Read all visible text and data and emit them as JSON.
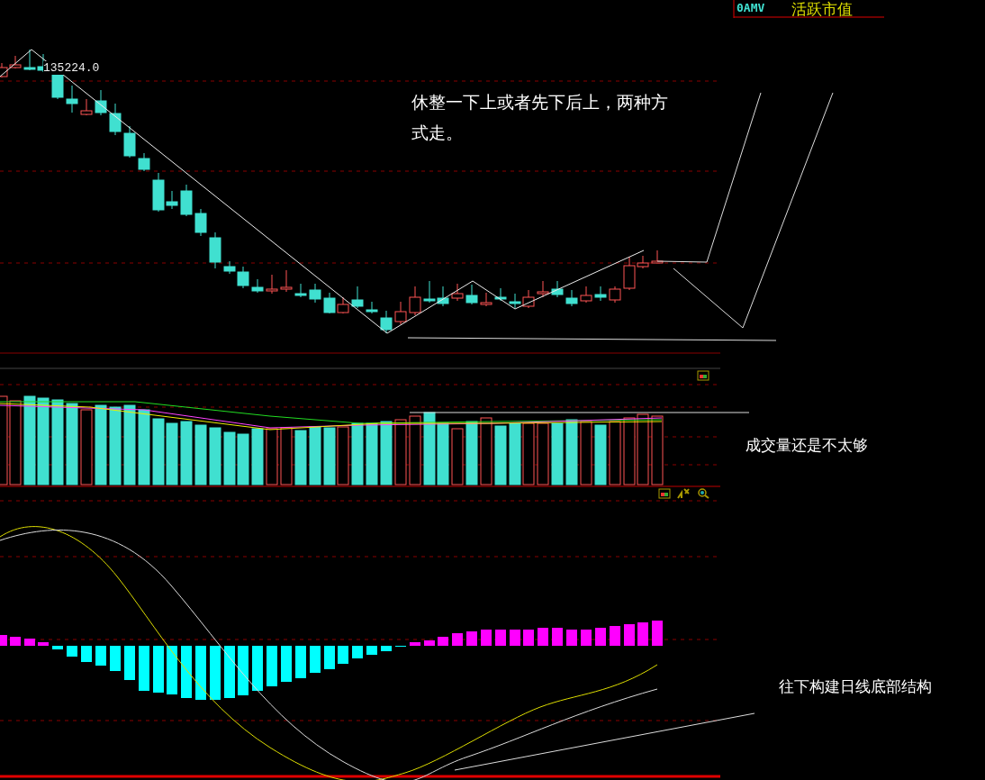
{
  "header": {
    "indicator": "0AMV",
    "title": "活跃市值"
  },
  "price_label": "135224.0",
  "notes": [
    {
      "text": "休整一下上或者先下后上，两种方式走。"
    },
    {
      "text": "成交量还是不太够"
    },
    {
      "text": "往下构建日线底部结构"
    }
  ]
}
